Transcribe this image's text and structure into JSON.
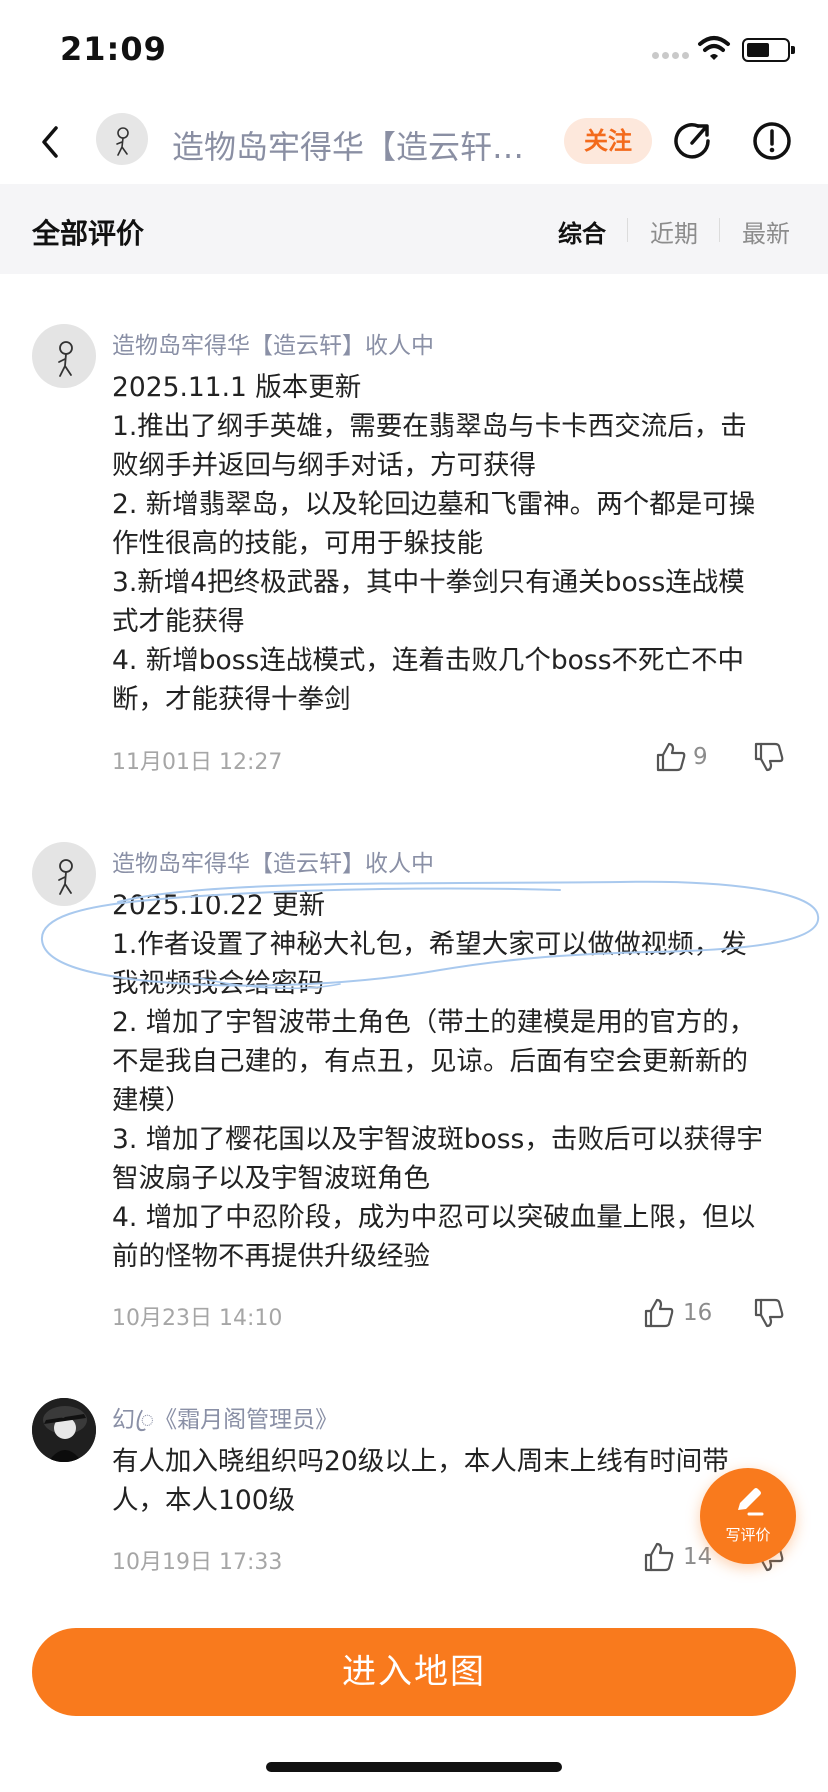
{
  "status_bar": {
    "time": "21:09"
  },
  "header": {
    "title": "造物岛牢得华【造云轩…",
    "follow_label": "关注"
  },
  "filter": {
    "title": "全部评价",
    "sort_options": [
      "综合",
      "近期",
      "最新"
    ],
    "active_sort": "综合"
  },
  "comments": [
    {
      "author": "造物岛牢得华【造云轩】收人中",
      "lines": [
        "2025.11.1 版本更新",
        "1.推出了纲手英雄，需要在翡翠岛与卡卡西交流后，击",
        "败纲手并返回与纲手对话，方可获得",
        "2. 新增翡翠岛，以及轮回边墓和飞雷神。两个都是可操",
        "作性很高的技能，可用于躲技能",
        "3.新增4把终极武器，其中十拳剑只有通关boss连战模",
        "式才能获得",
        "4. 新增boss连战模式，连着击败几个boss不死亡不中",
        "断，才能获得十拳剑"
      ],
      "date": "11月01日 12:27",
      "likes": "9"
    },
    {
      "author": "造物岛牢得华【造云轩】收人中",
      "lines": [
        "2025.10.22 更新",
        "1.作者设置了神秘大礼包，希望大家可以做做视频，发",
        "我视频我会给密码",
        "2. 增加了宇智波带土角色（带土的建模是用的官方的，",
        "不是我自己建的，有点丑，见谅。后面有空会更新新的",
        "建模）",
        "3. 增加了樱花国以及宇智波斑boss，击败后可以获得宇",
        "智波扇子以及宇智波斑角色",
        "4. 增加了中忍阶段，成为中忍可以突破血量上限，但以",
        "前的怪物不再提供升级经验"
      ],
      "date": "10月23日 14:10",
      "likes": "16"
    },
    {
      "author": "幻ꦿ《霜月阁管理员》",
      "lines": [
        "有人加入晓组织吗20级以上，本人周末上线有时间带",
        "人，本人100级"
      ],
      "date": "10月19日 17:33",
      "likes": "14"
    }
  ],
  "fab": {
    "label": "写评价"
  },
  "bottom_button": {
    "label": "进入地图"
  },
  "colors": {
    "accent": "#f97a1d",
    "name": "#8a90a6",
    "scribble": "#a9c9ee"
  },
  "icons": [
    "back-arrow-icon",
    "share-icon",
    "report-icon",
    "thumb-up-icon",
    "thumb-down-icon",
    "pen-icon",
    "wifi-icon",
    "battery-icon"
  ]
}
